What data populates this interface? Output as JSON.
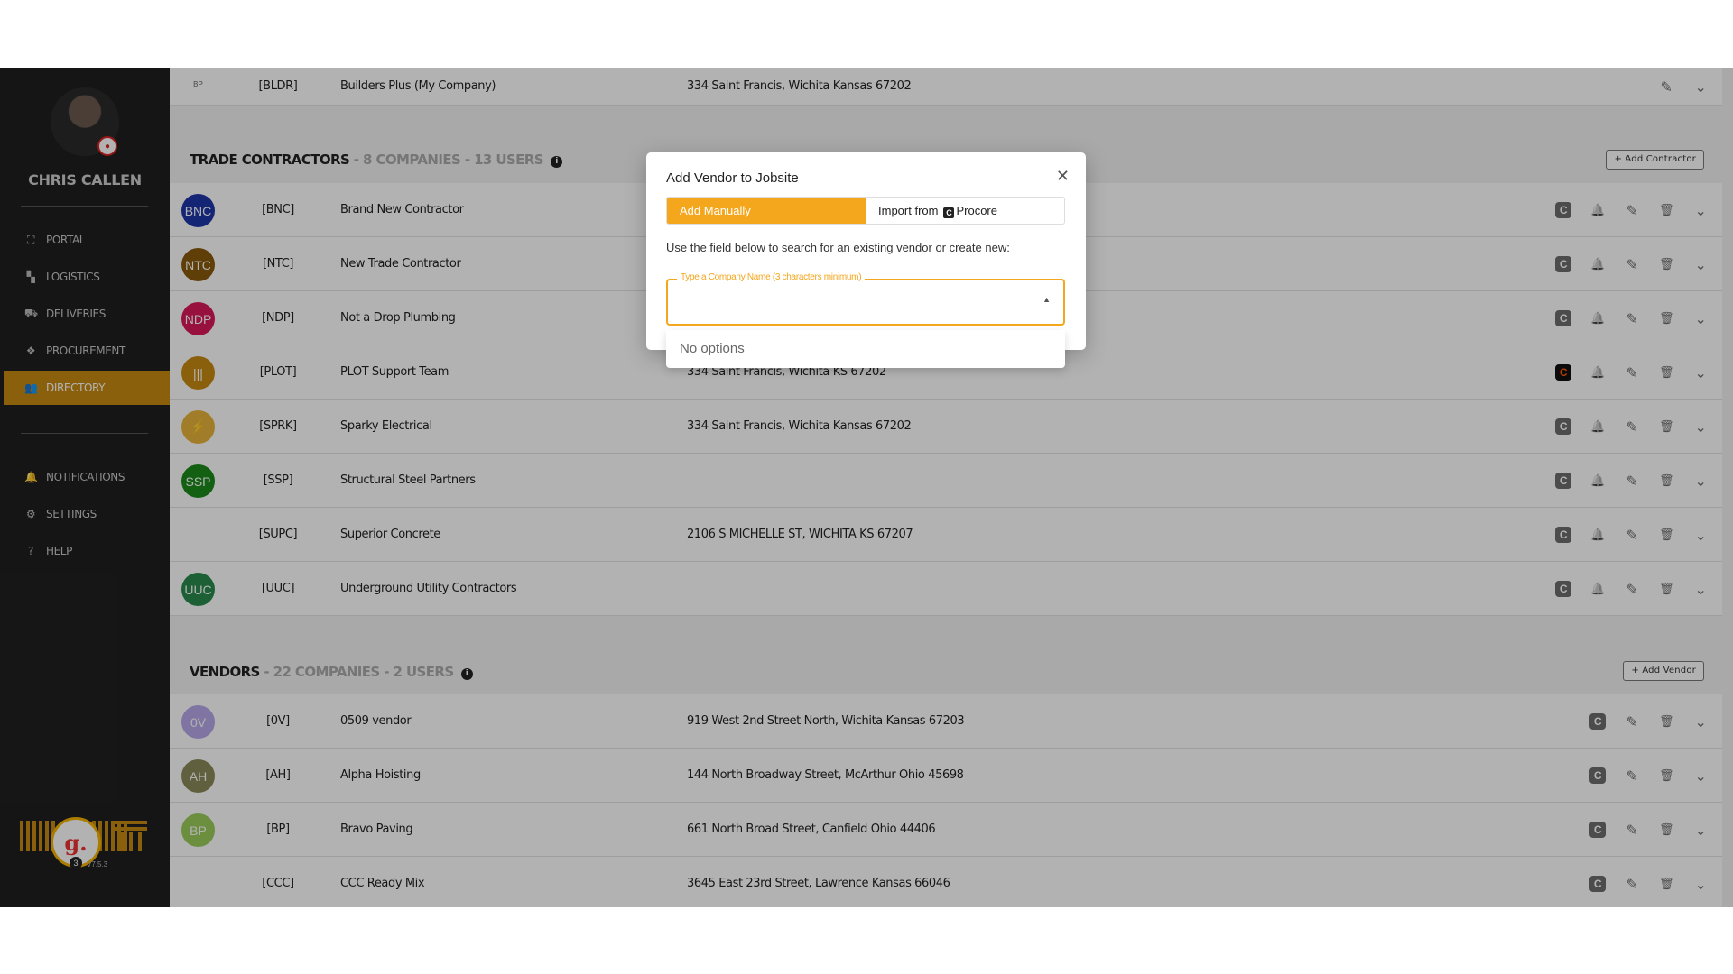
{
  "user": {
    "name": "CHRIS CALLEN"
  },
  "nav": {
    "primary": [
      {
        "label": "PORTAL",
        "icon": "sitemap-icon",
        "glyph": "⛶"
      },
      {
        "label": "LOGISTICS",
        "icon": "map-icon",
        "glyph": "▚"
      },
      {
        "label": "DELIVERIES",
        "icon": "truck-icon",
        "glyph": "⛟"
      },
      {
        "label": "PROCUREMENT",
        "icon": "cubes-icon",
        "glyph": "❖"
      },
      {
        "label": "DIRECTORY",
        "icon": "users-icon",
        "glyph": "👥"
      }
    ],
    "secondary": [
      {
        "label": "NOTIFICATIONS",
        "icon": "bell-icon",
        "glyph": "🔔"
      },
      {
        "label": "SETTINGS",
        "icon": "gear-icon",
        "glyph": "⚙"
      },
      {
        "label": "HELP",
        "icon": "help-icon",
        "glyph": "?"
      }
    ],
    "active": "DIRECTORY"
  },
  "brand": {
    "badge_count": "3",
    "version": "V7.5.3",
    "g_letter": "g."
  },
  "owner_row": {
    "code": "[BLDR]",
    "name": "Builders Plus (My Company)",
    "address": "334 Saint Francis, Wichita Kansas 67202"
  },
  "trade_contractors": {
    "title": "TRADE CONTRACTORS",
    "meta": " - 8 COMPANIES - 13 USERS",
    "add_label": "+ Add Contractor",
    "rows": [
      {
        "initials": "BNC",
        "color": "#1f35a8",
        "code": "[BNC]",
        "name": "Brand New Contractor",
        "address": ""
      },
      {
        "initials": "NTC",
        "color": "#8a5a0c",
        "code": "[NTC]",
        "name": "New Trade Contractor",
        "address": ""
      },
      {
        "initials": "NDP",
        "color": "#d8185a",
        "code": "[NDP]",
        "name": "Not a Drop Plumbing",
        "address": ""
      },
      {
        "initials": "|||",
        "color": "#c78a14",
        "code": "[PLOT]",
        "name": "PLOT Support Team",
        "address": "334 Saint Francis, Wichita KS 67202"
      },
      {
        "initials": "⚡",
        "color": "#e9b43b",
        "code": "[SPRK]",
        "name": "Sparky Electrical",
        "address": "334 Saint Francis, Wichita Kansas 67202"
      },
      {
        "initials": "SSP",
        "color": "#1c8a1c",
        "code": "[SSP]",
        "name": "Structural Steel Partners",
        "address": ""
      },
      {
        "initials": "",
        "color": "#ffffff",
        "code": "[SUPC]",
        "name": "Superior Concrete",
        "address": "2106 S MICHELLE ST, WICHITA KS 67207"
      },
      {
        "initials": "UUC",
        "color": "#2c8a4e",
        "code": "[UUC]",
        "name": "Underground Utility Contractors",
        "address": ""
      }
    ]
  },
  "vendors": {
    "title": "VENDORS",
    "meta": " - 22 COMPANIES - 2 USERS",
    "add_label": "+ Add Vendor",
    "rows": [
      {
        "initials": "0V",
        "color": "#b7a6e8",
        "code": "[0V]",
        "name": "0509 vendor",
        "address": "919 West 2nd Street North, Wichita Kansas 67203"
      },
      {
        "initials": "AH",
        "color": "#8a8a5a",
        "code": "[AH]",
        "name": "Alpha Hoisting",
        "address": "144 North Broadway Street, McArthur Ohio 45698"
      },
      {
        "initials": "BP",
        "color": "#9acd5a",
        "code": "[BP]",
        "name": "Bravo Paving",
        "address": "661 North Broad Street, Canfield Ohio 44406"
      },
      {
        "initials": "",
        "color": "#ffffff",
        "code": "[CCC]",
        "name": "CCC Ready Mix",
        "address": "3645 East 23rd Street, Lawrence Kansas 66046"
      }
    ]
  },
  "modal": {
    "title": "Add Vendor to Jobsite",
    "tab_manual": "Add Manually",
    "tab_import_prefix": "Import from",
    "tab_import_source": "Procore",
    "description": "Use the field below to search for an existing vendor or create new:",
    "field_label": "Type a Company Name (3 characters minimum)",
    "field_value": "",
    "no_options": "No options"
  }
}
